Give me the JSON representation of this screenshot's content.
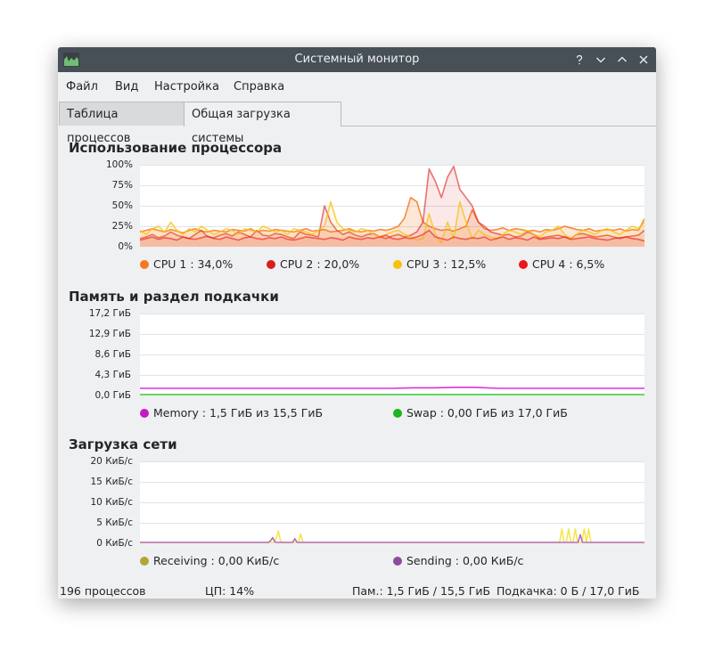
{
  "window": {
    "title": "Системный монитор"
  },
  "menu": [
    "Файл",
    "Вид",
    "Настройка",
    "Справка"
  ],
  "tabs": [
    "Таблица процессов",
    "Общая загрузка системы"
  ],
  "active_tab": 1,
  "sections": {
    "cpu": {
      "title": "Использование процессора",
      "y_ticks": [
        "100%",
        "75%",
        "50%",
        "25%",
        "0%"
      ],
      "legend": [
        {
          "label": "CPU 1 : 34,0%",
          "color": "#f47920"
        },
        {
          "label": "CPU 2 : 20,0%",
          "color": "#da1d1d"
        },
        {
          "label": "CPU 3 : 12,5%",
          "color": "#f7c10d"
        },
        {
          "label": "CPU 4 : 6,5%",
          "color": "#ed1515"
        }
      ]
    },
    "memory": {
      "title": "Память и раздел подкачки",
      "y_ticks": [
        "17,2 ГиБ",
        "12,9 ГиБ",
        "8,6 ГиБ",
        "4,3 ГиБ",
        "0,0 ГиБ"
      ],
      "legend": [
        {
          "label": "Memory : 1,5 ГиБ из 15,5 ГиБ",
          "color": "#c21bc2"
        },
        {
          "label": "Swap : 0,00 ГиБ из 17,0 ГиБ",
          "color": "#1db51d"
        }
      ]
    },
    "network": {
      "title": "Загрузка сети",
      "y_ticks": [
        "20 КиБ/с",
        "15 КиБ/с",
        "10 КиБ/с",
        "5 КиБ/с",
        "0 КиБ/с"
      ],
      "legend": [
        {
          "label": "Receiving : 0,00 КиБ/с",
          "color": "#b3a535"
        },
        {
          "label": "Sending : 0,00 КиБ/с",
          "color": "#8e4a9c"
        }
      ]
    }
  },
  "status": {
    "processes": "196 процессов",
    "cpu": "ЦП: 14%",
    "memory": "Пам.: 1,5 ГиБ / 15,5 ГиБ",
    "swap": "Подкачка: 0 Б / 17,0 ГиБ"
  },
  "chart_data": [
    {
      "type": "line",
      "title": "Использование процессора",
      "ylim": [
        0,
        100
      ],
      "series": [
        {
          "name": "CPU 1",
          "values": [
            18,
            20,
            22,
            20,
            18,
            21,
            19,
            17,
            20,
            22,
            19,
            18,
            20,
            19,
            18,
            21,
            20,
            19,
            22,
            18,
            20,
            19,
            21,
            20,
            19,
            18,
            20,
            22,
            19,
            20,
            21,
            18,
            19,
            20,
            22,
            19,
            18,
            20,
            19,
            21,
            20,
            22,
            25,
            35,
            60,
            55,
            30,
            25,
            22,
            20,
            21,
            19,
            22,
            25,
            45,
            30,
            22,
            20,
            21,
            23,
            20,
            22,
            21,
            19,
            20,
            18,
            21,
            20,
            22,
            25,
            23,
            21,
            20,
            22,
            19,
            20,
            21,
            20,
            22,
            19,
            21,
            20,
            34
          ]
        },
        {
          "name": "CPU 2",
          "values": [
            10,
            12,
            15,
            11,
            13,
            18,
            14,
            12,
            10,
            15,
            20,
            12,
            11,
            14,
            16,
            13,
            18,
            15,
            12,
            20,
            14,
            13,
            16,
            15,
            12,
            10,
            18,
            15,
            14,
            12,
            50,
            30,
            20,
            15,
            18,
            14,
            12,
            15,
            16,
            12,
            10,
            13,
            15,
            12,
            14,
            18,
            30,
            95,
            80,
            60,
            85,
            98,
            70,
            60,
            50,
            30,
            25,
            18,
            16,
            14,
            15,
            12,
            13,
            18,
            15,
            10,
            12,
            13,
            14,
            12,
            10,
            15,
            16,
            14,
            12,
            13,
            14,
            12,
            10,
            12,
            13,
            14,
            20
          ]
        },
        {
          "name": "CPU 3",
          "values": [
            20,
            15,
            22,
            25,
            18,
            30,
            20,
            15,
            22,
            18,
            25,
            20,
            15,
            18,
            22,
            20,
            15,
            22,
            20,
            18,
            25,
            22,
            18,
            20,
            15,
            22,
            20,
            18,
            15,
            20,
            25,
            55,
            30,
            22,
            20,
            18,
            22,
            20,
            15,
            12,
            15,
            18,
            20,
            15,
            12,
            8,
            10,
            40,
            15,
            5,
            30,
            10,
            55,
            30,
            10,
            20,
            15,
            12,
            10,
            15,
            20,
            18,
            15,
            20,
            15,
            12,
            18,
            20,
            25,
            15,
            10,
            15,
            20,
            18,
            15,
            20,
            22,
            18,
            15,
            20,
            25,
            22,
            30
          ]
        },
        {
          "name": "CPU 4",
          "values": [
            8,
            10,
            12,
            9,
            11,
            10,
            8,
            12,
            10,
            9,
            11,
            13,
            10,
            9,
            12,
            10,
            8,
            11,
            12,
            10,
            9,
            11,
            10,
            12,
            9,
            8,
            10,
            12,
            11,
            10,
            9,
            11,
            10,
            8,
            12,
            10,
            9,
            11,
            10,
            12,
            14,
            10,
            9,
            11,
            10,
            12,
            15,
            20,
            12,
            10,
            8,
            12,
            10,
            9,
            11,
            10,
            12,
            8,
            10,
            12,
            9,
            11,
            10,
            8,
            12,
            9,
            10,
            11,
            10,
            12,
            9,
            10,
            11,
            12,
            10,
            9,
            8,
            10,
            11,
            12,
            10,
            9,
            7
          ]
        }
      ]
    },
    {
      "type": "line",
      "title": "Память и раздел подкачки",
      "ylim": [
        0,
        17.2
      ],
      "series": [
        {
          "name": "Memory",
          "values": [
            1.5,
            1.5,
            1.5,
            1.5,
            1.5,
            1.5,
            1.5,
            1.5,
            1.5,
            1.5,
            1.5,
            1.5,
            1.5,
            1.6,
            1.6,
            1.7,
            1.7,
            1.5,
            1.5,
            1.5,
            1.5,
            1.5,
            1.5,
            1.5,
            1.5
          ]
        },
        {
          "name": "Swap",
          "values": [
            0,
            0,
            0,
            0,
            0,
            0,
            0,
            0,
            0,
            0,
            0,
            0,
            0,
            0,
            0,
            0,
            0,
            0,
            0,
            0,
            0,
            0,
            0,
            0,
            0
          ]
        }
      ]
    },
    {
      "type": "line",
      "title": "Загрузка сети",
      "ylim": [
        0,
        20
      ],
      "series": [
        {
          "name": "Receiving",
          "values": [
            0,
            0,
            0,
            0,
            0,
            0,
            0,
            0,
            0,
            0,
            0,
            0,
            0,
            0,
            0,
            0,
            0,
            0,
            0,
            0,
            0,
            0,
            0,
            0,
            0,
            0,
            0,
            0,
            0,
            0,
            0,
            0,
            0,
            0,
            0,
            0,
            0,
            0,
            0,
            0,
            0,
            0,
            0,
            0,
            0,
            0,
            0,
            0,
            0,
            0,
            0,
            0,
            0,
            0,
            0,
            0,
            0,
            0,
            0,
            0,
            0,
            1.2,
            3.0,
            0.5,
            0,
            0,
            0,
            0,
            0,
            0,
            0,
            0,
            2.3,
            0,
            0,
            0,
            0,
            0,
            0,
            0,
            0,
            0,
            0,
            0,
            0,
            0,
            0,
            0,
            0,
            0,
            0,
            0,
            0,
            0,
            0,
            0,
            0,
            0,
            0,
            0,
            0,
            0,
            0,
            0,
            0,
            0,
            0,
            0,
            0,
            0,
            0,
            0,
            0,
            0,
            0,
            0,
            0,
            0,
            0,
            0,
            0,
            0,
            0,
            0,
            0,
            0,
            0,
            0,
            0,
            0,
            0,
            0,
            0,
            0,
            0,
            0,
            0,
            0,
            0,
            0,
            0,
            0,
            0,
            0,
            0,
            0,
            0,
            0,
            0,
            0,
            0,
            0,
            0,
            0,
            0,
            0,
            0,
            0,
            0,
            0,
            0,
            0,
            0,
            0,
            0,
            0,
            0,
            0,
            0,
            0,
            0,
            0,
            0,
            0,
            0,
            0,
            0,
            0,
            0,
            0,
            0,
            0,
            0,
            0,
            0,
            0,
            0,
            0,
            0,
            3.5,
            0,
            0,
            3.5,
            0,
            0,
            3.5,
            0,
            0,
            0,
            3.5,
            0,
            3.5,
            0,
            0,
            0,
            0,
            0,
            0,
            0,
            0,
            0,
            0,
            0,
            0,
            0,
            0,
            0,
            0,
            0,
            0,
            0,
            0,
            0,
            0,
            0,
            0,
            0
          ]
        },
        {
          "name": "Sending",
          "values": [
            0,
            0,
            0,
            0,
            0,
            0,
            0,
            0,
            0,
            0,
            0,
            0,
            0,
            0,
            0,
            0,
            0,
            0,
            0,
            0,
            0,
            0,
            0,
            0,
            0,
            0,
            0,
            0,
            0,
            0,
            0,
            0,
            0,
            0,
            0,
            0,
            0,
            0,
            0,
            0,
            0,
            0,
            0,
            0,
            0,
            0,
            0,
            0,
            0,
            0,
            0,
            0,
            0,
            0,
            0,
            0,
            0,
            0,
            0,
            0.6,
            1.4,
            0.3,
            0,
            0,
            0,
            0,
            0,
            0,
            0,
            0,
            1.1,
            0,
            0,
            0,
            0,
            0,
            0,
            0,
            0,
            0,
            0,
            0,
            0,
            0,
            0,
            0,
            0,
            0,
            0,
            0,
            0,
            0,
            0,
            0,
            0,
            0,
            0,
            0,
            0,
            0,
            0,
            0,
            0,
            0,
            0,
            0,
            0,
            0,
            0,
            0,
            0,
            0,
            0,
            0,
            0,
            0,
            0,
            0,
            0,
            0,
            0,
            0,
            0,
            0,
            0,
            0,
            0,
            0,
            0,
            0,
            0,
            0,
            0,
            0,
            0,
            0,
            0,
            0,
            0,
            0,
            0,
            0,
            0,
            0,
            0,
            0,
            0,
            0,
            0,
            0,
            0,
            0,
            0,
            0,
            0,
            0,
            0,
            0,
            0,
            0,
            0,
            0,
            0,
            0,
            0,
            0,
            0,
            0,
            0,
            0,
            0,
            0,
            0,
            0,
            0,
            0,
            0,
            0,
            0,
            0,
            0,
            0,
            0,
            0,
            0,
            0,
            0,
            0,
            0,
            0,
            0,
            0,
            0,
            0,
            0,
            0,
            0,
            0,
            0,
            2.1,
            0,
            0,
            0,
            0,
            0,
            0,
            0,
            0,
            0,
            0,
            0,
            0,
            0,
            0,
            0,
            0,
            0,
            0,
            0,
            0,
            0,
            0,
            0,
            0,
            0,
            0,
            0,
            0,
            0
          ]
        }
      ]
    }
  ]
}
